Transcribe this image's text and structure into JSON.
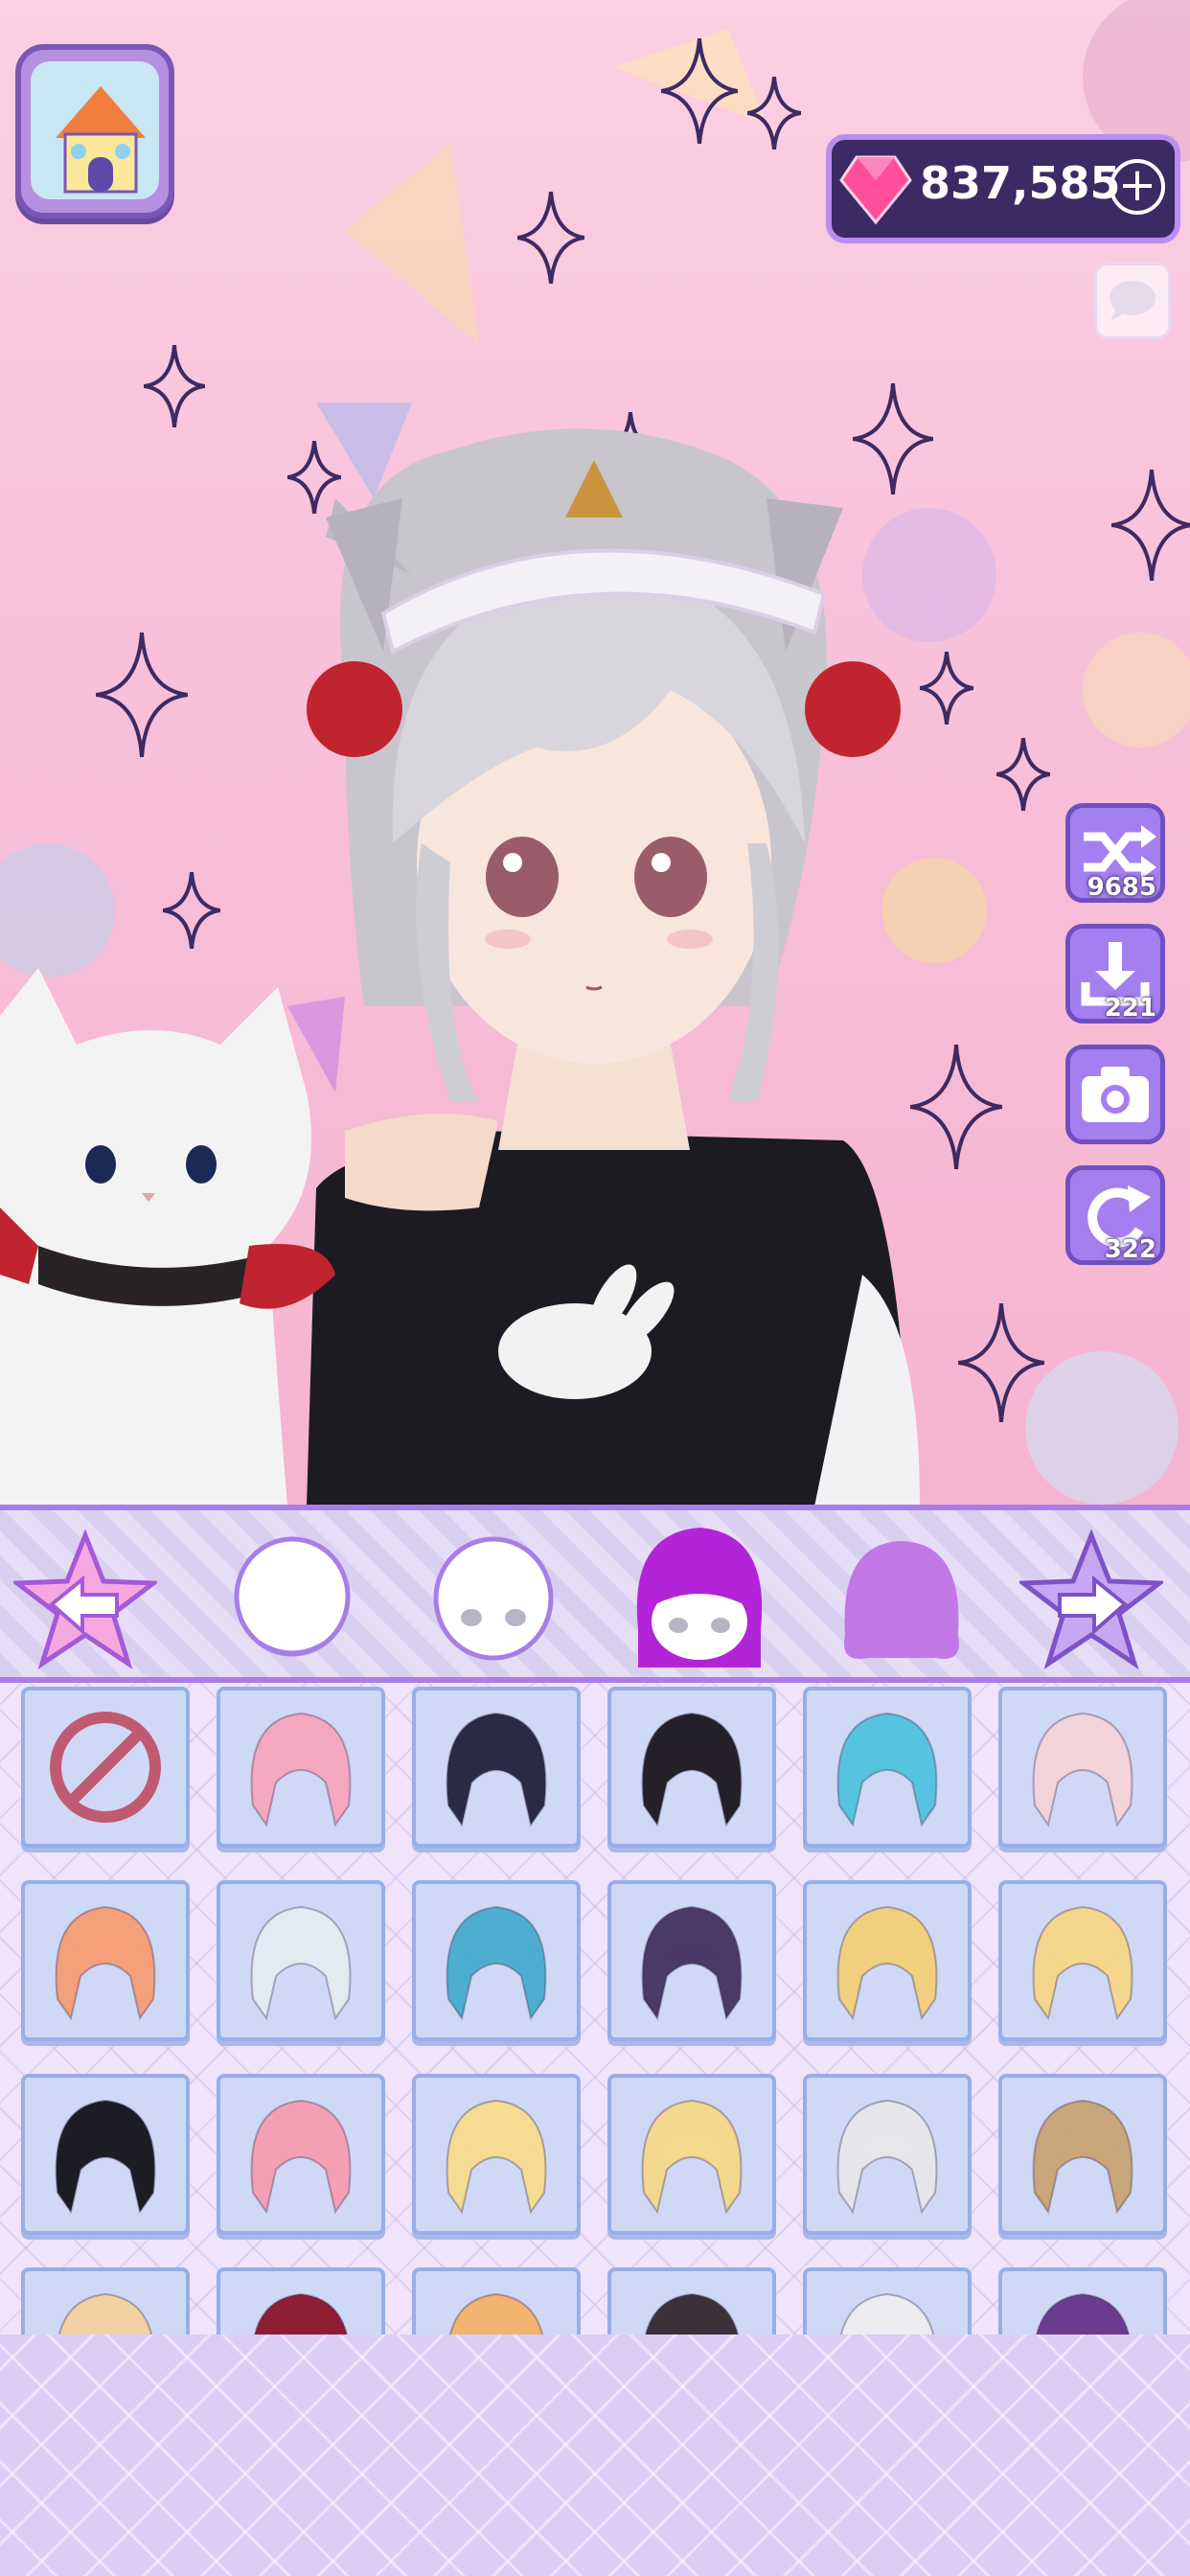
{
  "currency": {
    "gems": "837,585",
    "plus_symbol": "+",
    "gem_color": "#ff4f9a"
  },
  "side_actions": [
    {
      "name": "randomize",
      "icon": "shuffle-icon",
      "count": "9685"
    },
    {
      "name": "download",
      "icon": "download-icon",
      "count": "221"
    },
    {
      "name": "camera",
      "icon": "camera-icon",
      "count": ""
    },
    {
      "name": "undo",
      "icon": "undo-icon",
      "count": "322"
    }
  ],
  "categories": [
    {
      "icon": "head-base-icon",
      "selected": false
    },
    {
      "icon": "face-icon",
      "selected": false
    },
    {
      "icon": "front-hair-icon",
      "selected": true
    },
    {
      "icon": "back-hair-icon",
      "selected": false
    }
  ],
  "nav": {
    "prev_icon": "arrow-left-star-icon",
    "next_icon": "arrow-right-star-icon"
  },
  "hair_options": [
    {
      "type": "none",
      "color": ""
    },
    {
      "type": "hair",
      "color": "#f5a8c0"
    },
    {
      "type": "hair",
      "color": "#2b2a44"
    },
    {
      "type": "hair",
      "color": "#24202a"
    },
    {
      "type": "hair",
      "color": "#56c3df"
    },
    {
      "type": "hair",
      "color": "#f3d3da"
    },
    {
      "type": "hair",
      "color": "#f4a07a"
    },
    {
      "type": "hair",
      "color": "#e3ebf2"
    },
    {
      "type": "hair",
      "color": "#4eaed0"
    },
    {
      "type": "hair",
      "color": "#4a3a66"
    },
    {
      "type": "hair",
      "color": "#f0cf7e"
    },
    {
      "type": "hair",
      "color": "#f4d78c"
    },
    {
      "type": "hair",
      "color": "#1c1c24"
    },
    {
      "type": "hair",
      "color": "#f3a0b4"
    },
    {
      "type": "hair",
      "color": "#f5dc92"
    },
    {
      "type": "hair",
      "color": "#f3d98e"
    },
    {
      "type": "hair",
      "color": "#e6e6ea"
    },
    {
      "type": "hair",
      "color": "#c9a679"
    },
    {
      "type": "hair",
      "color": "#f2d2a2"
    },
    {
      "type": "hair",
      "color": "#8e1e34"
    },
    {
      "type": "hair",
      "color": "#f1b36e"
    },
    {
      "type": "hair",
      "color": "#3a3238"
    },
    {
      "type": "hair",
      "color": "#ececf0"
    },
    {
      "type": "hair",
      "color": "#6b3c8e"
    }
  ],
  "colors": {
    "accent": "#a77ee8",
    "panel_dark": "#3b2a63",
    "tile_bg": "#cfd9f6"
  }
}
